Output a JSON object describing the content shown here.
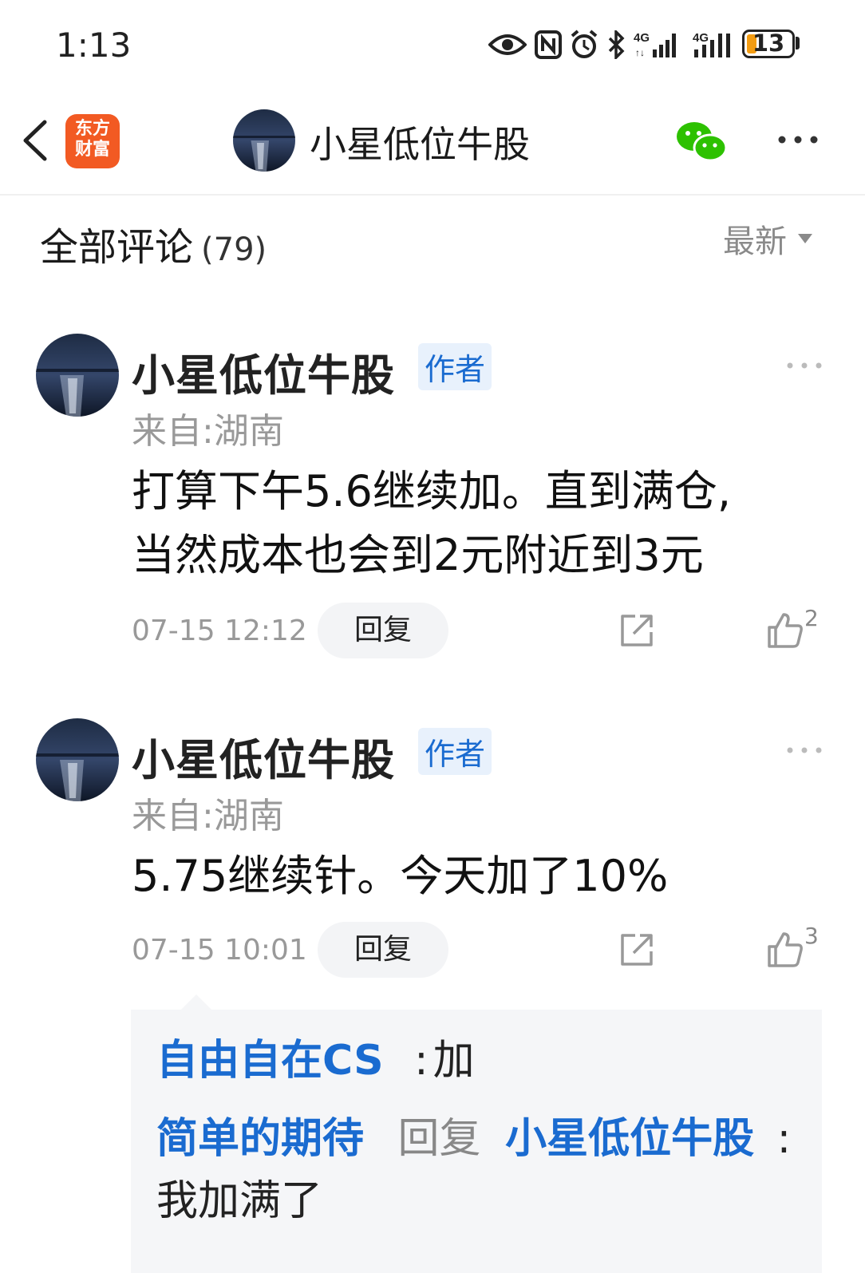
{
  "status_bar": {
    "time": "1:13",
    "battery": "13",
    "icons": [
      "eye-icon",
      "nfc-icon",
      "alarm-icon",
      "bluetooth-icon",
      "signal-4g-icon",
      "signal-4g-icon"
    ]
  },
  "nav": {
    "logo_line1": "东方",
    "logo_line2": "财富",
    "title": "小星低位牛股"
  },
  "section": {
    "title": "全部评论",
    "count": "(79)",
    "sort_label": "最新"
  },
  "comments": [
    {
      "author": "小星低位牛股",
      "badge": "作者",
      "location": "来自:湖南",
      "text_line1": "打算下午5.6继续加。直到满仓,",
      "text_line2": "当然成本也会到2元附近到3元",
      "time": "07-15 12:12",
      "reply_label": "回复",
      "likes": "2"
    },
    {
      "author": "小星低位牛股",
      "badge": "作者",
      "location": "来自:湖南",
      "text_line1": "5.75继续针。今天加了10%",
      "time": "07-15 10:01",
      "reply_label": "回复",
      "likes": "3"
    }
  ],
  "replies": [
    {
      "user": "自由自在CS",
      "separator": ":",
      "text": "加"
    },
    {
      "user": "简单的期待",
      "reply_word": "回复",
      "target": "小星低位牛股",
      "separator": ":",
      "text": "我加满了"
    }
  ],
  "colors": {
    "accent": "#1a6bd0",
    "logo": "#f25a23",
    "wechat": "#2dc100"
  }
}
